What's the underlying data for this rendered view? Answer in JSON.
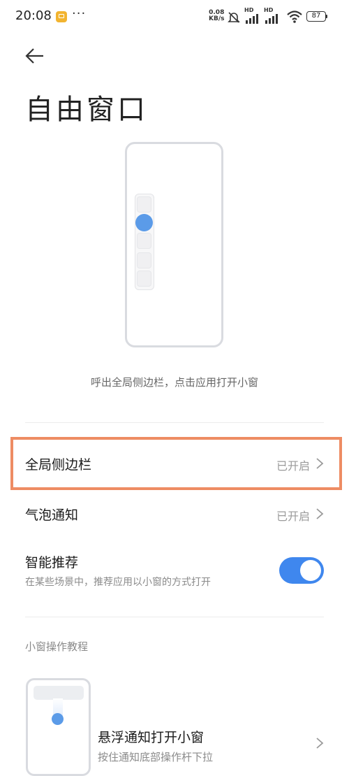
{
  "status_bar": {
    "time": "20:08",
    "more": "···",
    "net_speed_value": "0.08",
    "net_speed_unit": "KB/s",
    "sim1_label": "HD",
    "sim2_label": "HD",
    "battery": "87",
    "icons": [
      "notes-app-icon",
      "mute-icon",
      "signal-icon",
      "signal-icon",
      "wifi-icon",
      "battery-icon"
    ]
  },
  "header": {
    "back_icon": "back-arrow-icon",
    "title": "自由窗口"
  },
  "illustration": {
    "caption": "呼出全局侧边栏，点击应用打开小窗"
  },
  "settings": {
    "global_sidebar": {
      "label": "全局侧边栏",
      "value": "已开启"
    },
    "bubble_notification": {
      "label": "气泡通知",
      "value": "已开启"
    },
    "smart_recommend": {
      "label": "智能推荐",
      "description": "在某些场景中，推荐应用以小窗的方式打开",
      "enabled": true
    }
  },
  "tutorial": {
    "section_title": "小窗操作教程",
    "items": [
      {
        "title": "悬浮通知打开小窗",
        "description": "按住通知底部操作杆下拉"
      }
    ]
  },
  "colors": {
    "accent": "#3f87ee",
    "highlight_border": "#ee8c63",
    "illustration_dot": "#5b9be8"
  }
}
